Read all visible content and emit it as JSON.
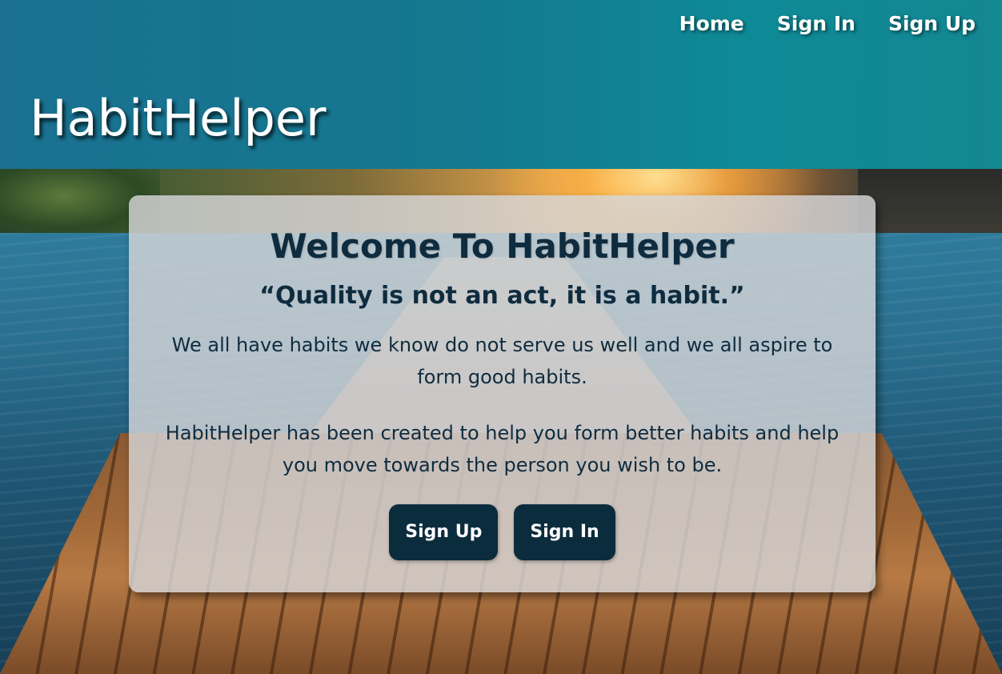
{
  "nav": {
    "links": [
      {
        "label": "Home"
      },
      {
        "label": "Sign In"
      },
      {
        "label": "Sign Up"
      }
    ]
  },
  "header": {
    "brand": "HabitHelper"
  },
  "card": {
    "title": "Welcome To HabitHelper",
    "quote": "“Quality is not an act, it is a habit.”",
    "paragraph1": "We all have habits we know do not serve us well and we all aspire to form good habits.",
    "paragraph2": "HabitHelper has been created to help you form better habits and help you move towards the person you wish to be.",
    "buttons": {
      "sign_up": "Sign Up",
      "sign_in": "Sign In"
    }
  },
  "colors": {
    "header_bg": "#14788f",
    "text_dark": "#0f2c3f",
    "button_bg": "#0b2c3d",
    "card_bg": "#d6d6d8"
  }
}
